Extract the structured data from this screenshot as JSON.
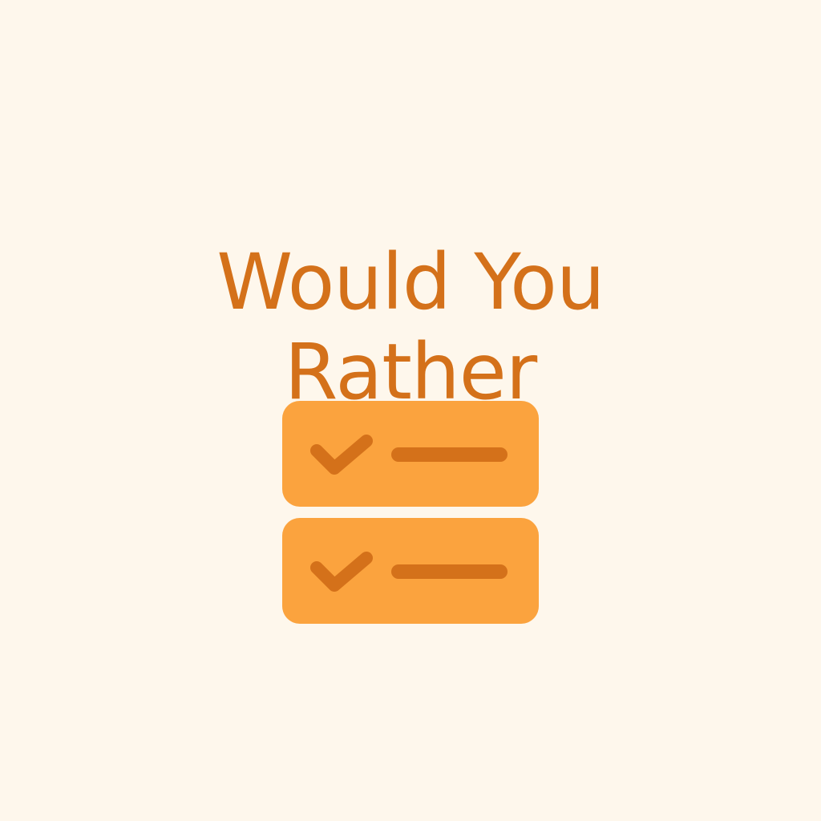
{
  "title": {
    "line1": "Would You",
    "line2": "Rather"
  },
  "logo": {
    "options": [
      {
        "icon": "checkmark-icon"
      },
      {
        "icon": "checkmark-icon"
      }
    ]
  },
  "colors": {
    "background": "#FEF7EC",
    "accent": "#D4711A",
    "card": "#FBA33E"
  }
}
